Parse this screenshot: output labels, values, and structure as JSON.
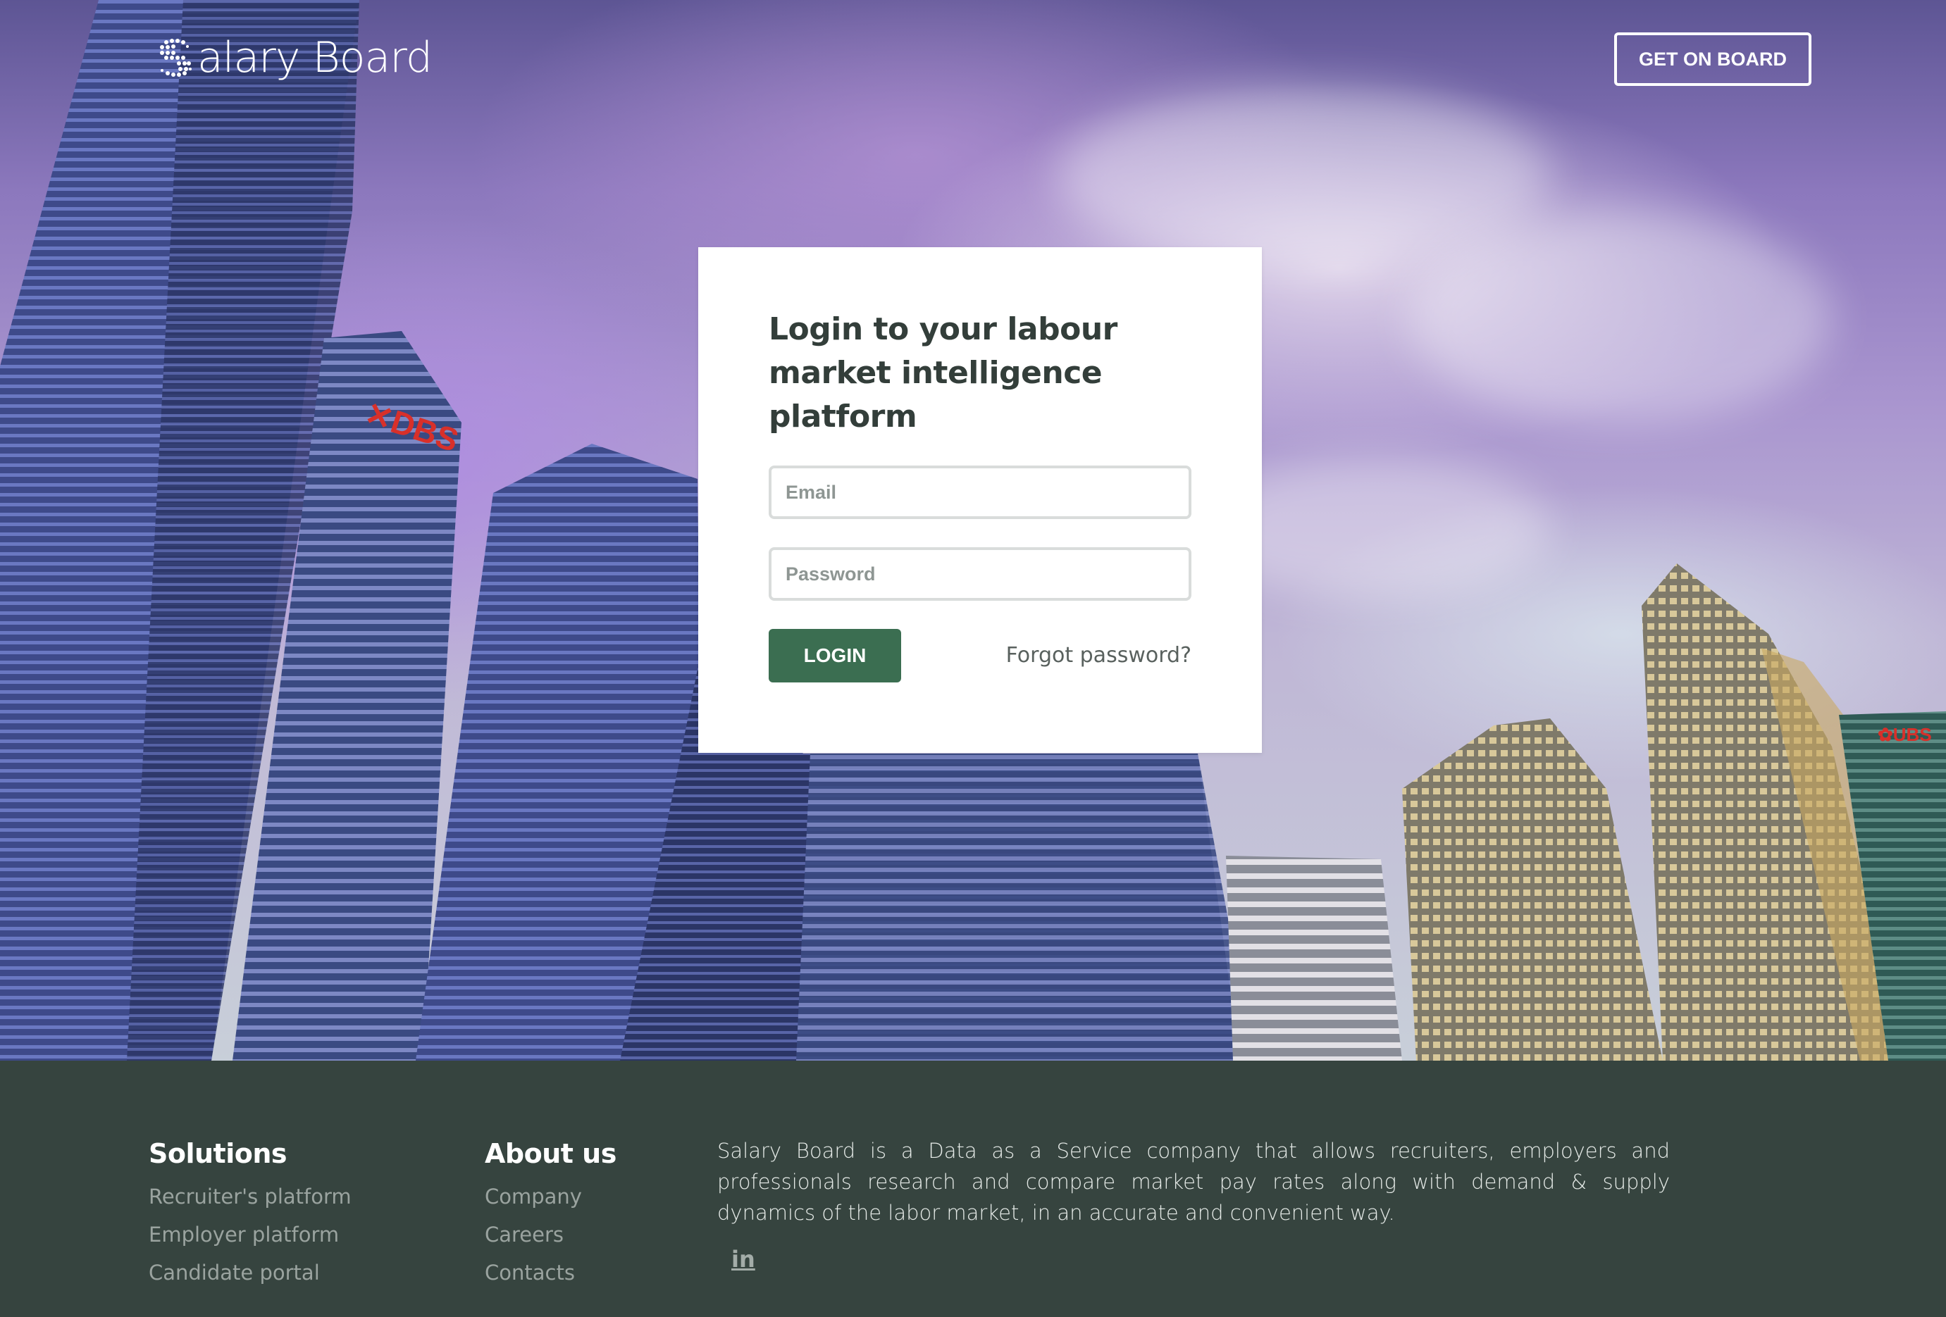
{
  "header": {
    "logo_text": "alary Board",
    "logo_initial": "S",
    "cta_label": "GET ON BOARD"
  },
  "login": {
    "title": "Login to your labour market intelligence platform",
    "email_placeholder": "Email",
    "password_placeholder": "Password",
    "login_label": "LOGIN",
    "forgot_label": "Forgot password?"
  },
  "footer": {
    "solutions": {
      "title": "Solutions",
      "links": [
        "Recruiter's platform",
        "Employer platform",
        "Candidate portal"
      ]
    },
    "about": {
      "title": "About us",
      "links": [
        "Company",
        "Careers",
        "Contacts"
      ]
    },
    "description": "Salary Board is a Data as a Service company that allows recruiters, employers and professionals research and compare market pay rates along with demand & supply dynamics of the labor market, in an accurate and convenient way.",
    "social_icon": "in"
  },
  "colors": {
    "primary_green": "#3b6e51",
    "footer_bg": "#36443f",
    "title_text": "#333e3a"
  }
}
